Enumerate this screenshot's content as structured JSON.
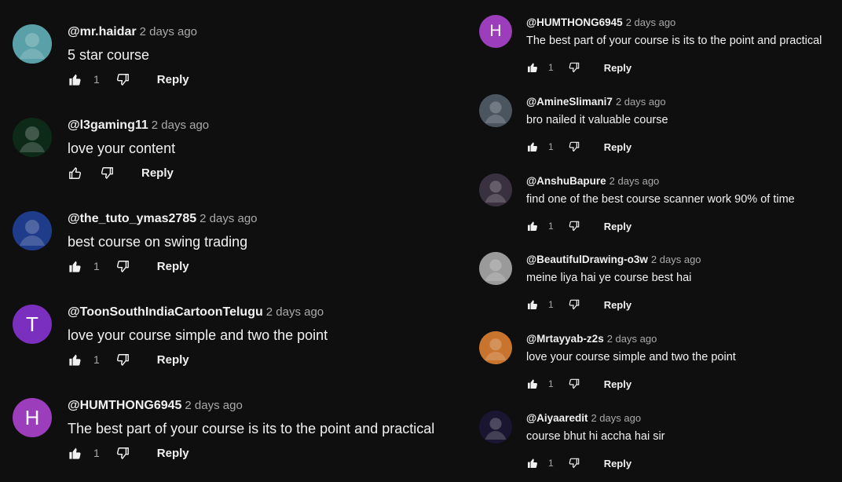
{
  "reply_label": "Reply",
  "left_comments": [
    {
      "author": "@mr.haidar",
      "time": "2 days ago",
      "text": "5 star course",
      "likes": "1",
      "avatar_icon": "cartoon-avatar-icon",
      "avatar_letter": "",
      "avatar_color": "#5aa0a8"
    },
    {
      "author": "@l3gaming11",
      "time": "2 days ago",
      "text": "love your content",
      "likes": "",
      "avatar_icon": "gaming-logo-avatar-icon",
      "avatar_letter": "",
      "avatar_color": "#0d2a18"
    },
    {
      "author": "@the_tuto_ymas2785",
      "time": "2 days ago",
      "text": "best course on swing trading",
      "likes": "1",
      "avatar_icon": "gamepad-avatar-icon",
      "avatar_letter": "",
      "avatar_color": "#1f3c8a"
    },
    {
      "author": "@ToonSouthIndiaCartoonTelugu",
      "time": "2 days ago",
      "text": "love your course simple and two the point",
      "likes": "1",
      "avatar_icon": "",
      "avatar_letter": "T",
      "avatar_color": "#7b2fbe"
    },
    {
      "author": "@HUMTHONG6945",
      "time": "2 days ago",
      "text": "The best part of your course is its to the point and practical",
      "likes": "1",
      "avatar_icon": "",
      "avatar_letter": "H",
      "avatar_color": "#9c3dbc"
    }
  ],
  "right_comments": [
    {
      "author": "@HUMTHONG6945",
      "time": "2 days ago",
      "text": "The best part of your course is its to the point and practical",
      "likes": "1",
      "avatar_icon": "",
      "avatar_letter": "H",
      "avatar_color": "#9c3dbc"
    },
    {
      "author": "@AmineSlimani7",
      "time": "2 days ago",
      "text": "bro nailed it valuable course",
      "likes": "1",
      "avatar_icon": "person-photo-avatar-icon",
      "avatar_letter": "",
      "avatar_color": "#4a5560"
    },
    {
      "author": "@AnshuBapure",
      "time": "2 days ago",
      "text": "find one of the best course scanner work 90% of time",
      "likes": "1",
      "avatar_icon": "emblem-avatar-icon",
      "avatar_letter": "",
      "avatar_color": "#3a3140"
    },
    {
      "author": "@BeautifulDrawing-o3w",
      "time": "2 days ago",
      "text": "meine liya hai ye course best hai",
      "likes": "1",
      "avatar_icon": "sketch-avatar-icon",
      "avatar_letter": "",
      "avatar_color": "#9a9a9a"
    },
    {
      "author": "@Mrtayyab-z2s",
      "time": "2 days ago",
      "text": "love your course simple and two the point",
      "likes": "1",
      "avatar_icon": "person-photo-avatar-icon",
      "avatar_letter": "",
      "avatar_color": "#c8742e"
    },
    {
      "author": "@Aiyaaredit",
      "time": "2 days ago",
      "text": "course bhut hi accha hai sir",
      "likes": "1",
      "avatar_icon": "neon-avatar-icon",
      "avatar_letter": "",
      "avatar_color": "#1a1530"
    }
  ]
}
